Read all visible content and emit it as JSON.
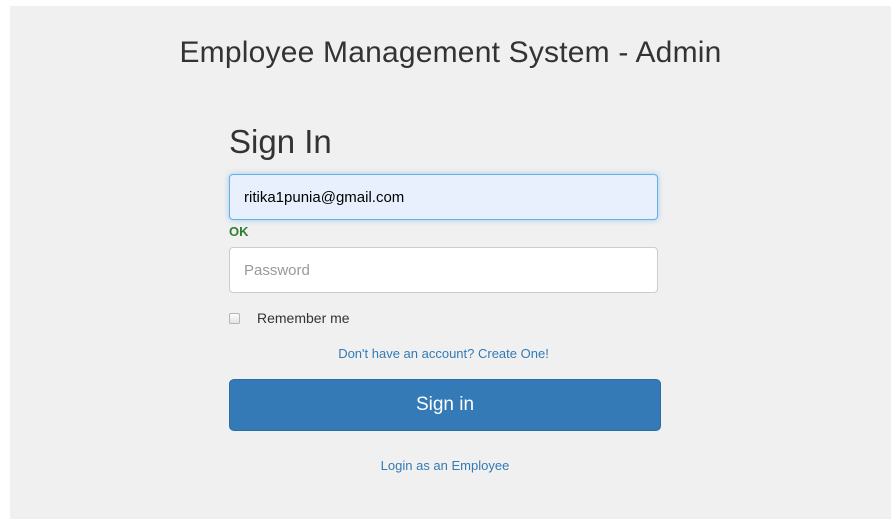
{
  "app": {
    "title": "Employee Management System - Admin"
  },
  "form": {
    "heading": "Sign In",
    "email": {
      "value": "ritika1punia@gmail.com",
      "validation_text": "OK"
    },
    "password": {
      "value": "",
      "placeholder": "Password"
    },
    "remember_me": {
      "label": "Remember me",
      "checked": false
    },
    "create_account_link": "Don't have an account? Create One!",
    "submit_label": "Sign in",
    "employee_login_link": "Login as an Employee"
  },
  "colors": {
    "primary": "#337ab7",
    "valid": "#2e7d32",
    "background": "#f0f0f0",
    "autofill": "#e8f0fe"
  },
  "icons": {
    "checkbox": "empty-checkbox"
  }
}
